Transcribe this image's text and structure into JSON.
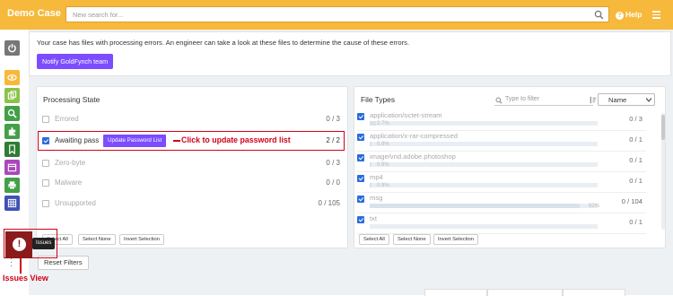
{
  "app": {
    "title": "Demo Case"
  },
  "search": {
    "placeholder": "New search for..."
  },
  "header": {
    "help_label": "Help"
  },
  "banner": {
    "message": "Your case has files with processing errors. An engineer can take a look at these files to determine the cause of these errors.",
    "button_label": "Notify GoldFynch team"
  },
  "processing_state": {
    "title": "Processing State",
    "rows": [
      {
        "label": "Errored",
        "count": "0 / 3",
        "checked": false
      },
      {
        "label": "Awaiting pass",
        "count": "2 / 2",
        "checked": true
      },
      {
        "label": "Zero-byte",
        "count": "0 / 3",
        "checked": false
      },
      {
        "label": "Malware",
        "count": "0 / 0",
        "checked": false
      },
      {
        "label": "Unsupported",
        "count": "0 / 105",
        "checked": false
      }
    ],
    "update_button_label": "Update Password List",
    "buttons": {
      "select_all": "Select All",
      "select_none": "Select None",
      "invert": "Invert Selection"
    }
  },
  "file_types": {
    "title": "File Types",
    "filter_placeholder": "Type to filter",
    "sort_value": "Name",
    "rows": [
      {
        "label": "application/octet-stream",
        "pct": "2.7%",
        "fraction": 0.027,
        "count": "0 / 3"
      },
      {
        "label": "application/x-rar-compressed",
        "pct": "0.9%",
        "fraction": 0.009,
        "count": "0 / 1"
      },
      {
        "label": "image/vnd.adobe.photoshop",
        "pct": "0.9%",
        "fraction": 0.009,
        "count": "0 / 1"
      },
      {
        "label": "mp4",
        "pct": "0.9%",
        "fraction": 0.009,
        "count": "0 / 1"
      },
      {
        "label": "msg",
        "pct": "92%",
        "fraction": 0.92,
        "count": "0 / 104"
      },
      {
        "label": "txt",
        "pct": "",
        "fraction": 0.0,
        "count": "0 / 1"
      }
    ],
    "buttons": {
      "select_all": "Select All",
      "select_none": "Select None",
      "invert": "Invert Selection"
    }
  },
  "reset_filters_label": "Reset Filters",
  "annotations": {
    "update_password": "Click to update password list",
    "issues_view": "Issues View",
    "issues_tooltip": "Issues"
  },
  "colors": {
    "accent": "#f6b93b",
    "button": "#7c4dff",
    "annotation": "#d0021b"
  }
}
